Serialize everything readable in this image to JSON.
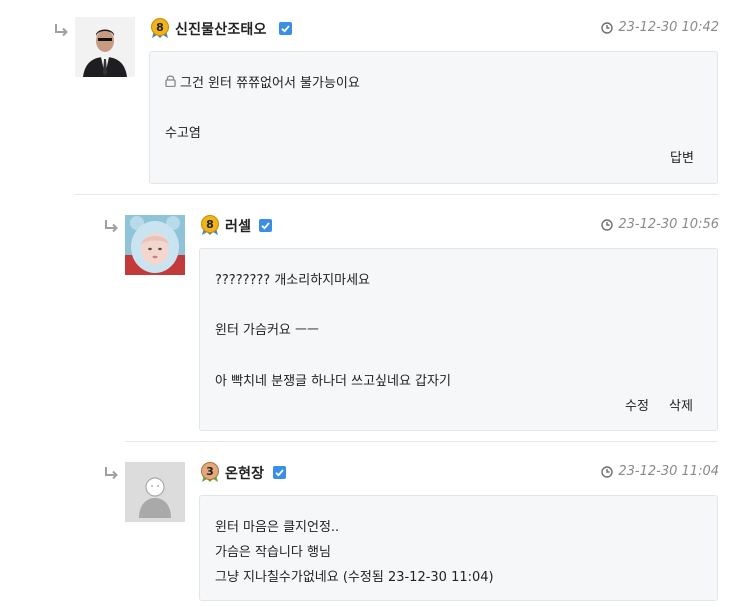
{
  "comments": [
    {
      "nickname": "신진물산조태오",
      "level": "8",
      "datetime": "23-12-30 10:42",
      "lines": [
        "그건 윈터 쮸쮸없어서 불가능이요",
        "수고염"
      ],
      "actions": [
        "답변"
      ]
    },
    {
      "nickname": "러셀",
      "level": "8",
      "datetime": "23-12-30 10:56",
      "lines": [
        "???????? 개소리하지마세요",
        "윈터 가슴커요 ㅡㅡ",
        "아 빡치네 분쟁글 하나더 쓰고싶네요 갑자기"
      ],
      "actions": [
        "수정",
        "삭제"
      ]
    },
    {
      "nickname": "온현장",
      "level": "3",
      "datetime": "23-12-30 11:04",
      "lines": [
        "윈터 마음은 클지언정..",
        "가슴은 작습니다 행님",
        "그냥 지나칠수가없네요 (수정됨 23-12-30 11:04)"
      ],
      "actions": []
    }
  ],
  "colors": {
    "verified": "#3b8ee6",
    "level_gold": "#f1b418",
    "level_green": "#55b43c",
    "bubble_bg": "#f6f7f8",
    "date_text": "#8a8a8a"
  },
  "icons": {
    "reply": "reply-arrow-icon",
    "clock": "clock-icon",
    "lock": "lock-icon",
    "verified": "verified-check-icon"
  }
}
